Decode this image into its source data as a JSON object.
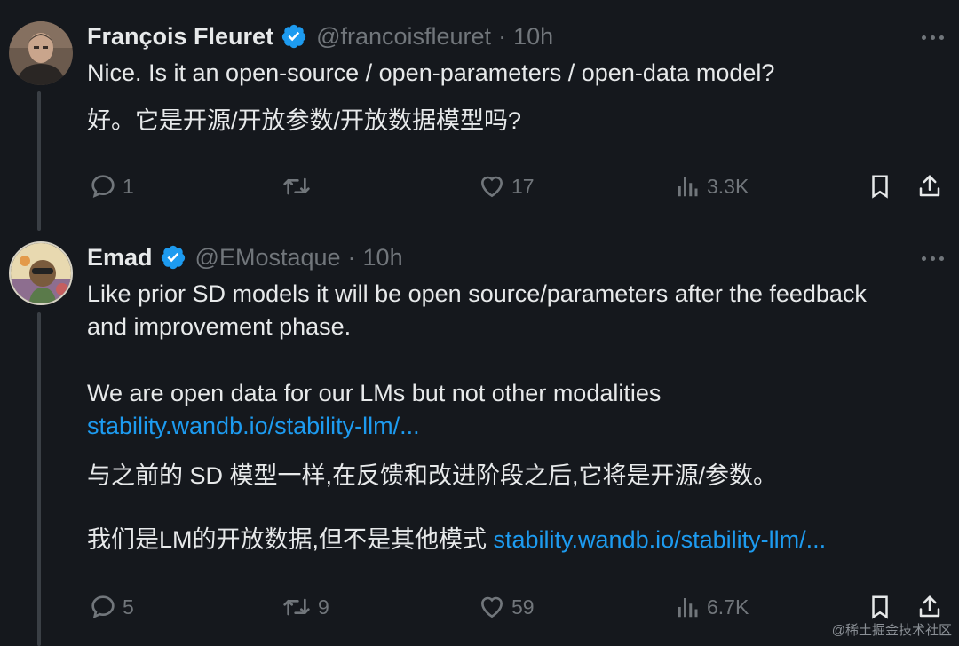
{
  "tweets": [
    {
      "name": "François Fleuret",
      "handle": "@francoisfleuret",
      "dot": "·",
      "time": "10h",
      "text_en": "Nice. Is it an open-source / open-parameters / open-data model?",
      "text_zh": "好。它是开源/开放参数/开放数据模型吗?",
      "replies": "1",
      "retweets": "",
      "likes": "17",
      "views": "3.3K"
    },
    {
      "name": "Emad",
      "handle": "@EMostaque",
      "dot": "·",
      "time": "10h",
      "text_en_line1": "Like prior SD models it will be open source/parameters after the feedback",
      "text_en_line2": "and improvement phase.",
      "text_en_line3": "We are open data for our LMs but not other modalities",
      "link1": "stability.wandb.io/stability-llm/...",
      "text_zh_line1": "与之前的 SD 模型一样,在反馈和改进阶段之后,它将是开源/参数。",
      "text_zh_line2": "我们是LM的开放数据,但不是其他模式 ",
      "link2": "stability.wandb.io/stability-llm/...",
      "replies": "5",
      "retweets": "9",
      "likes": "59",
      "views": "6.7K"
    }
  ],
  "watermark": "@稀土掘金技术社区",
  "colors": {
    "background": "#15181d",
    "text": "#e7e9ea",
    "muted": "#71767b",
    "link": "#1d9bf0",
    "verified": "#1d9bf0"
  },
  "icons": [
    "verified-badge-icon",
    "more-icon",
    "reply-icon",
    "retweet-icon",
    "like-icon",
    "views-icon",
    "bookmark-icon",
    "share-icon"
  ]
}
